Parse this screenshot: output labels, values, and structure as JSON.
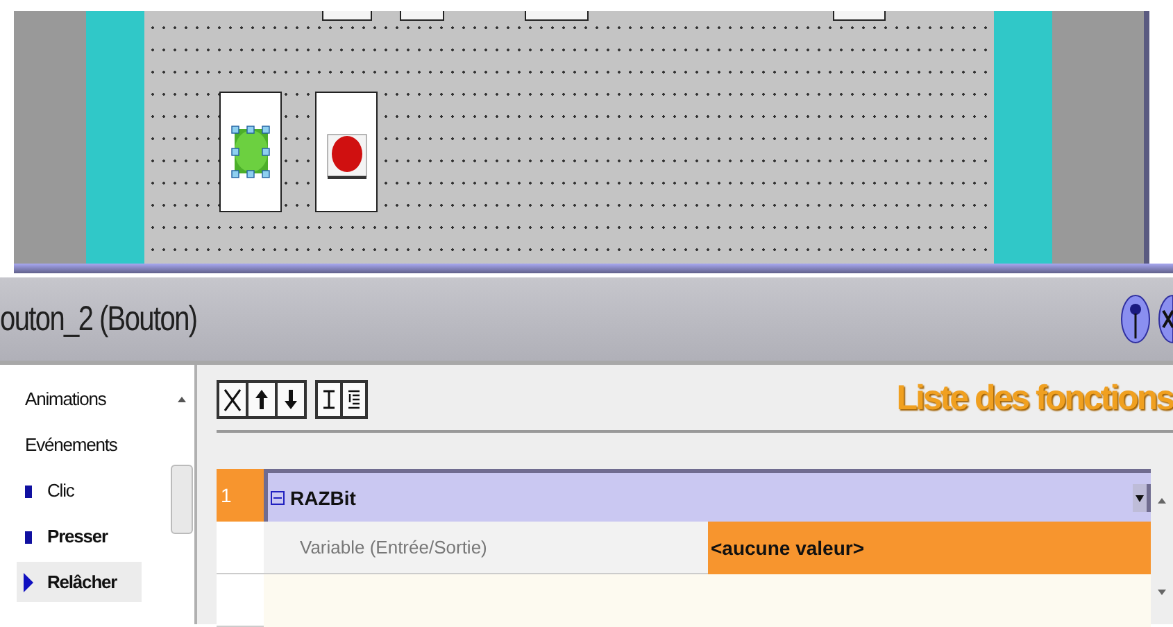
{
  "canvas": {
    "objects": [
      {
        "kind": "selected-button"
      },
      {
        "kind": "stop-button"
      }
    ]
  },
  "panel": {
    "title": "outon_2 (Bouton)"
  },
  "events": [
    {
      "label": "Animations",
      "kind": "header",
      "selected": false
    },
    {
      "label": "Evénements",
      "kind": "header",
      "selected": false
    },
    {
      "label": "Clic",
      "kind": "event",
      "configured": false,
      "selected": false
    },
    {
      "label": "Presser",
      "kind": "event",
      "configured": true,
      "selected": false
    },
    {
      "label": "Relâcher",
      "kind": "event",
      "configured": true,
      "selected": true
    }
  ],
  "functions": {
    "heading": "Liste des fonctions",
    "rows": [
      {
        "kind": "function",
        "number": "1",
        "name": "RAZBit",
        "expanded": true
      },
      {
        "kind": "parameter",
        "name": "Variable (Entrée/Sortie)",
        "value": "<aucune valeur>"
      }
    ]
  }
}
